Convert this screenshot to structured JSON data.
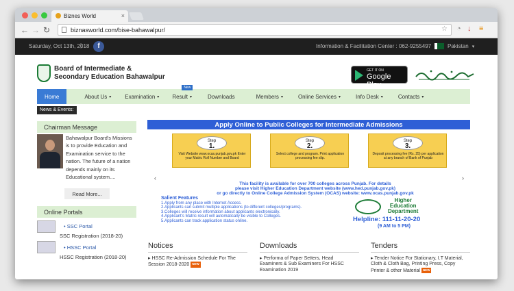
{
  "browser": {
    "tab_title": "Biznes World",
    "url": "biznasworld.com/bise-bahawalpur/"
  },
  "topbar": {
    "date": "Saturday, Oct 13th, 2018",
    "separator": "|",
    "facebook": "f",
    "info": "Information & Facilitation Center : 062-9255497",
    "country": "Pakistan"
  },
  "header": {
    "board_line1": "Board of Intermediate &",
    "board_line2": "Secondary Education Bahawalpur",
    "gplay_small": "GET IT ON",
    "gplay_big": "Google Play"
  },
  "menu": {
    "items": [
      "Home",
      "About Us",
      "Examination",
      "Result",
      "Downloads",
      "Members",
      "Online Services",
      "Info Desk",
      "Contacts"
    ],
    "new_badge": "New"
  },
  "news_label": "News & Events:",
  "chairman": {
    "heading": "Chairman Message",
    "text": "Bahawalpur Board's Missions is to provide Education and Examination service to the nation. The future of a nation depends mainly on its Educational system....",
    "read_more": "Read More..."
  },
  "portals": {
    "heading": "Online Portals",
    "items": [
      {
        "link": "SSC Portal",
        "reg": "SSC Registration (2018-20)"
      },
      {
        "link": "HSSC Portal",
        "reg": "HSSC Registration (2018-20)"
      }
    ]
  },
  "banner": {
    "title": "Apply Online to Public Colleges for Intermediate Admissions",
    "steps": [
      {
        "label": "Step",
        "num": "1.",
        "text": "Visit Website www.ocas.punjab.gov.pk Enter your Matric Roll Number and Board"
      },
      {
        "label": "Step",
        "num": "2.",
        "text": "Select college and program. Print application processing fee slip."
      },
      {
        "label": "Step",
        "num": "3.",
        "text": "Deposit processing fee (Rs. 25) per application at any branch of Bank of Punjab"
      }
    ],
    "line1": "This facility is available for over 700 colleges across Punjab. For details",
    "line2": "please visit Higher Education Department website (www.hed.punjab.gov.pk)",
    "line3": "or go directly to Online College Admission System (OCAS) website: www.ocas.punjab.gov.pk",
    "salient_head": "Salient Features",
    "salient": [
      "1.Apply from any place with Internet Access.",
      "2.Applicants can submit multiple applications (to different colleges/programs).",
      "3.Colleges will receive information about applicants electronically.",
      "4.Applicant's Matric result will automatically be visible to Colleges.",
      "5.Applicants can track application status online."
    ],
    "hed_line1": "Higher",
    "hed_line2": "Education",
    "hed_line3": "Department",
    "helpline": "Helpline: 111-11-20-20",
    "hours": "(9 AM to 5 PM)"
  },
  "notices": {
    "heading": "Notices",
    "items": [
      "HSSC Re-Admission Schedule For The Session 2018-2020"
    ]
  },
  "downloads": {
    "heading": "Downloads",
    "items": [
      "Performa of Paper Setters, Head Examiners & Sub Examiners For HSSC Examination 2019"
    ]
  },
  "tenders": {
    "heading": "Tenders",
    "items": [
      "Tender Notice For Stationary, I.T Material, Cloth & Cloth Bag, Printing Press, Copy Printer & other Material"
    ]
  },
  "new_tag": "NEW",
  "colors": {
    "menu_bg": "#dcefd3",
    "home_active": "#3a7bd5",
    "banner_blue": "#2e5fd6",
    "step_yellow": "#f7cf52"
  }
}
